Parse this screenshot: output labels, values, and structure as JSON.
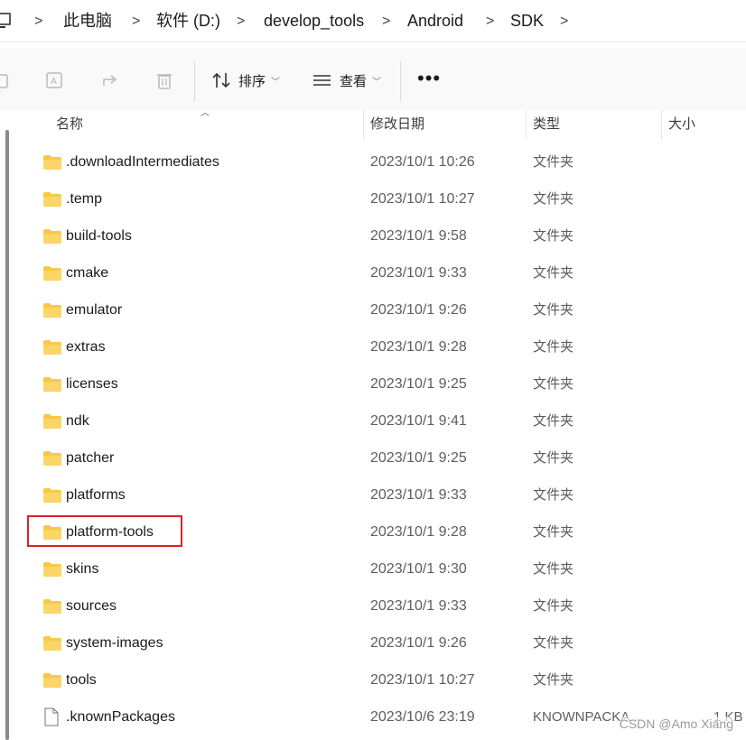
{
  "breadcrumb": {
    "items": [
      "此电脑",
      "软件 (D:)",
      "develop_tools",
      "Android",
      "SDK"
    ],
    "separator": ">"
  },
  "toolbar": {
    "sort_label": "排序",
    "view_label": "查看",
    "more_label": "•••"
  },
  "columns": {
    "name": "名称",
    "date": "修改日期",
    "type": "类型",
    "size": "大小"
  },
  "rows": [
    {
      "name": ".downloadIntermediates",
      "date": "2023/10/1 10:26",
      "type": "文件夹",
      "size": "",
      "kind": "folder"
    },
    {
      "name": ".temp",
      "date": "2023/10/1 10:27",
      "type": "文件夹",
      "size": "",
      "kind": "folder"
    },
    {
      "name": "build-tools",
      "date": "2023/10/1 9:58",
      "type": "文件夹",
      "size": "",
      "kind": "folder"
    },
    {
      "name": "cmake",
      "date": "2023/10/1 9:33",
      "type": "文件夹",
      "size": "",
      "kind": "folder"
    },
    {
      "name": "emulator",
      "date": "2023/10/1 9:26",
      "type": "文件夹",
      "size": "",
      "kind": "folder"
    },
    {
      "name": "extras",
      "date": "2023/10/1 9:28",
      "type": "文件夹",
      "size": "",
      "kind": "folder"
    },
    {
      "name": "licenses",
      "date": "2023/10/1 9:25",
      "type": "文件夹",
      "size": "",
      "kind": "folder"
    },
    {
      "name": "ndk",
      "date": "2023/10/1 9:41",
      "type": "文件夹",
      "size": "",
      "kind": "folder"
    },
    {
      "name": "patcher",
      "date": "2023/10/1 9:25",
      "type": "文件夹",
      "size": "",
      "kind": "folder"
    },
    {
      "name": "platforms",
      "date": "2023/10/1 9:33",
      "type": "文件夹",
      "size": "",
      "kind": "folder"
    },
    {
      "name": "platform-tools",
      "date": "2023/10/1 9:28",
      "type": "文件夹",
      "size": "",
      "kind": "folder"
    },
    {
      "name": "skins",
      "date": "2023/10/1 9:30",
      "type": "文件夹",
      "size": "",
      "kind": "folder"
    },
    {
      "name": "sources",
      "date": "2023/10/1 9:33",
      "type": "文件夹",
      "size": "",
      "kind": "folder"
    },
    {
      "name": "system-images",
      "date": "2023/10/1 9:26",
      "type": "文件夹",
      "size": "",
      "kind": "folder"
    },
    {
      "name": "tools",
      "date": "2023/10/1 10:27",
      "type": "文件夹",
      "size": "",
      "kind": "folder"
    },
    {
      "name": ".knownPackages",
      "date": "2023/10/6 23:19",
      "type": "KNOWNPACKA...",
      "size": "1 KB",
      "kind": "file"
    }
  ],
  "watermark": "CSDN @Amo Xiang",
  "colors": {
    "folder": "#f8c846",
    "highlight": "#e02020",
    "toolbar_bg": "#f9f9f9"
  },
  "icons": [
    "computer-icon",
    "copy-icon",
    "rename-icon",
    "share-icon",
    "delete-icon",
    "sort-icon",
    "view-icon",
    "folder-icon",
    "file-icon"
  ]
}
